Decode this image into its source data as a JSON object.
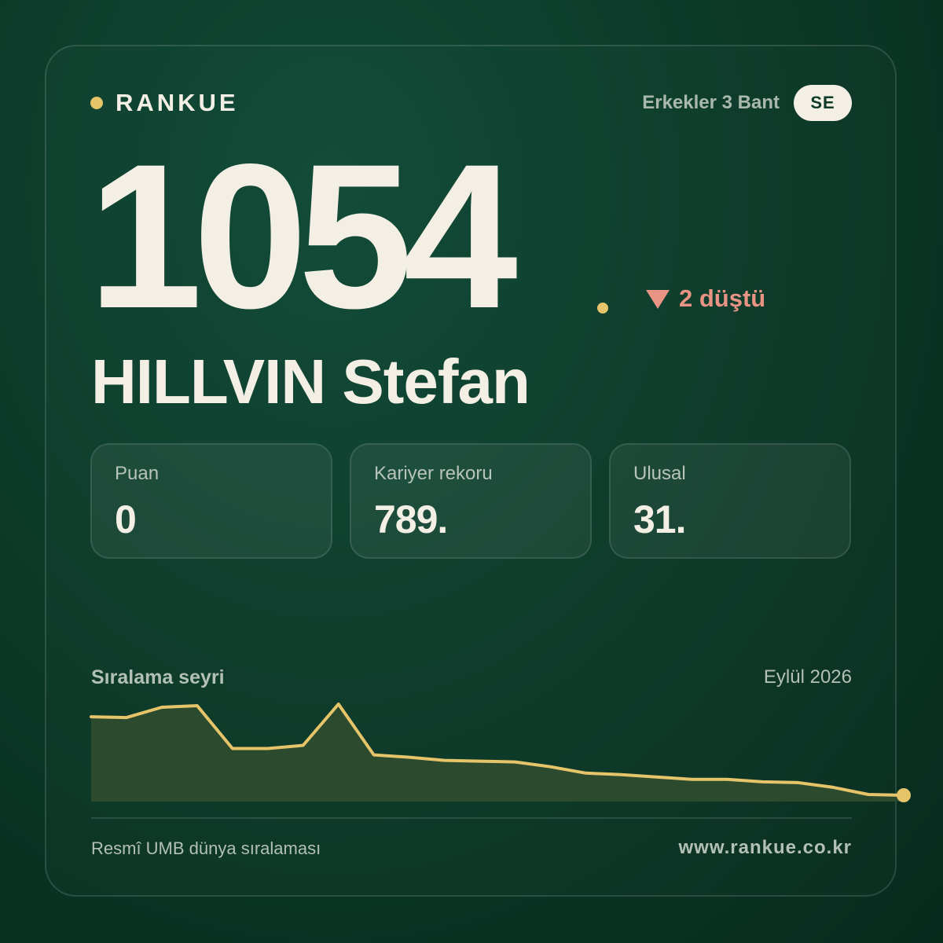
{
  "brand": {
    "name": "RANKUE"
  },
  "category": {
    "label": "Erkekler 3 Bant",
    "country_code": "SE"
  },
  "rank": {
    "number": "1054",
    "change_text": "2 düştü"
  },
  "player": {
    "name": "HILLVIN Stefan"
  },
  "stats": [
    {
      "label": "Puan",
      "value": "0"
    },
    {
      "label": "Kariyer rekoru",
      "value": "789."
    },
    {
      "label": "Ulusal",
      "value": "31."
    }
  ],
  "chart": {
    "title": "Sıralama seyri",
    "date": "Eylül 2026"
  },
  "footer": {
    "source": "Resmî UMB dünya sıralaması",
    "url": "www.rankue.co.kr"
  },
  "colors": {
    "accent": "#e6c56a",
    "down": "#e99385",
    "background": "#0c3a29",
    "text": "#f4efe4"
  },
  "chart_data": {
    "type": "area",
    "title": "Sıralama seyri",
    "xlabel": "",
    "ylabel": "",
    "x": [
      1,
      2,
      3,
      4,
      5,
      6,
      7,
      8,
      9,
      10,
      11,
      12,
      13,
      14,
      15,
      16,
      17,
      18,
      19,
      20,
      21,
      22,
      23
    ],
    "series": [
      {
        "values": [
          1003,
          1004,
          991,
          989,
          1043,
          1043,
          1039,
          987,
          1051,
          1054,
          1058,
          1059,
          1060,
          1066,
          1074,
          1076,
          1079,
          1082,
          1082,
          1085,
          1086,
          1092,
          1101,
          1102
        ]
      }
    ]
  }
}
